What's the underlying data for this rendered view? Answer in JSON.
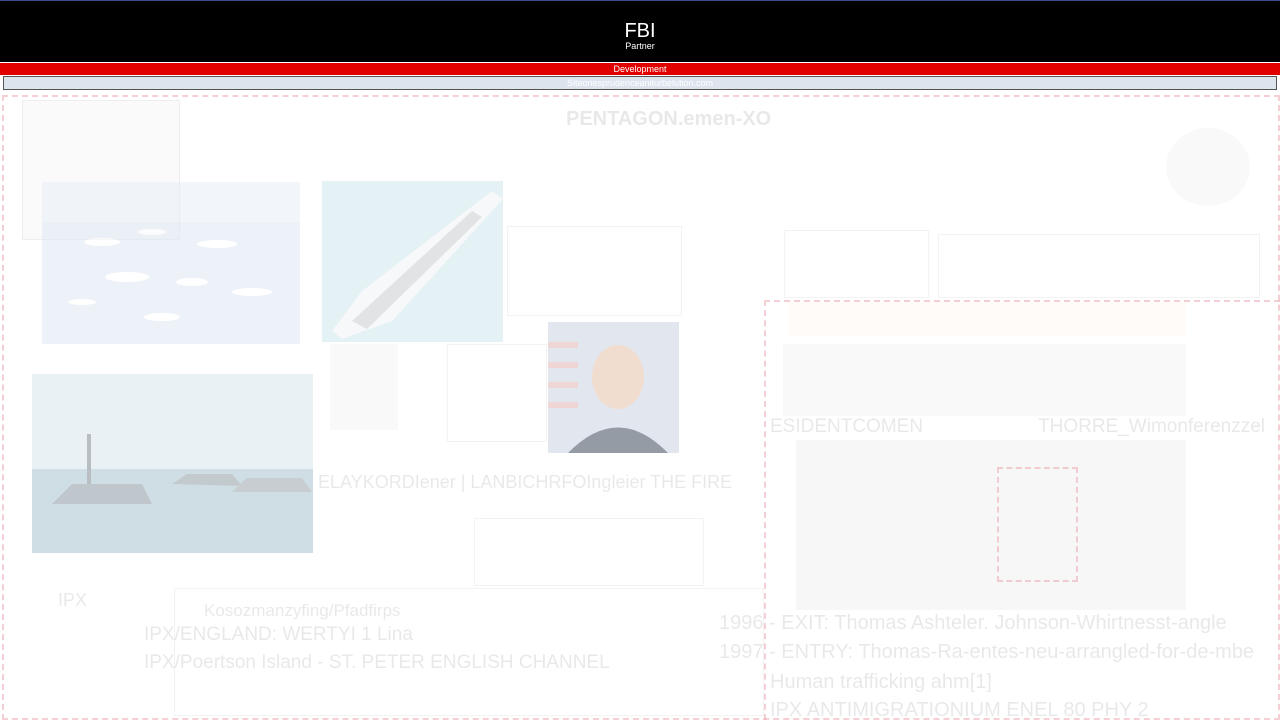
{
  "header": {
    "title": "FBI",
    "subtitle": "Partner",
    "banner": "Development",
    "link_text": "Siteonesprudenceaniturbelution.com"
  },
  "main": {
    "page_title": "PENTAGON.emen-XO",
    "caption_1": "ELAYKORDIener | LANBICHRFOIngleier THE FIRE",
    "label_ipx": "IPX",
    "heading_small": "Kosozmanzyfing/Pfadfirps",
    "line_1": "IPX/ENGLAND: WERTYI 1 Lina",
    "line_2": "IPX/Poertson Island - ST. PETER ENGLISH CHANNEL",
    "right_label_1": "ESIDENTCOMEN",
    "right_label_2": "THORRE_Wimonferenzzel",
    "timeline": [
      "1996 - EXIT: Thomas Ashteler. Johnson-Whirtnesst-angle",
      "1997 - ENTRY: Thomas-Ra-entes-neu-arrangled-for-de-mbe",
      "Human trafficking ahm[1]",
      "IPX ANTIMIGRATIONIUM ENEL 80 PHY 2"
    ]
  },
  "colors": {
    "topbar": "#000000",
    "banner": "#e00000",
    "dashed_outline": "#eb96a0"
  }
}
